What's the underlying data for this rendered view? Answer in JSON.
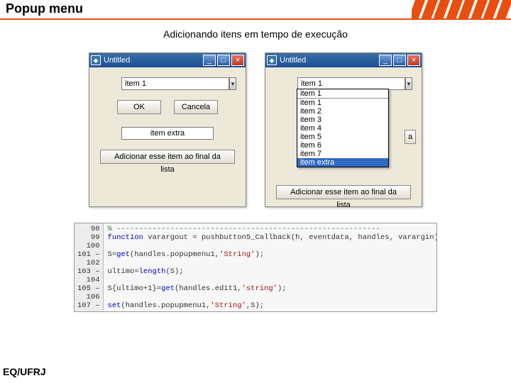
{
  "header": {
    "title": "Popup menu"
  },
  "subtitle": "Adicionando itens em tempo de execução",
  "win_left": {
    "title": "Untitled",
    "min": "_",
    "max": "□",
    "close": "×",
    "combo_value": "item 1",
    "btn_ok": "OK",
    "btn_cancel": "Cancela",
    "edit_value": "item extra",
    "btn_add": "Adicionar esse item ao final da lista"
  },
  "win_right": {
    "title": "Untitled",
    "min": "_",
    "max": "□",
    "close": "×",
    "combo_selected": "item 1",
    "options": [
      "item 1",
      "item 2",
      "item 3",
      "item 4",
      "item 5",
      "item 6",
      "item 7",
      "item extra"
    ],
    "partial_cancel_letter": "a",
    "btn_add": "Adicionar esse item ao final da lista"
  },
  "code": {
    "gutter": [
      "98",
      "99",
      "100",
      "101 –",
      "102",
      "103 –",
      "104",
      "105 –",
      "106",
      "107 –"
    ],
    "lines": [
      {
        "cls": "c-comment",
        "t": "% -----------------------------------------------------------"
      },
      {
        "cls": "",
        "t": "function varargout = pushbutton5_Callback(h, eventdata, handles, varargin)"
      },
      {
        "cls": "",
        "t": ""
      },
      {
        "cls": "",
        "t": "S=get(handles.popupmenu1,'String');"
      },
      {
        "cls": "",
        "t": ""
      },
      {
        "cls": "",
        "t": "ultimo=length(S);"
      },
      {
        "cls": "",
        "t": ""
      },
      {
        "cls": "",
        "t": "S{ultimo+1}=get(handles.edit1,'string');"
      },
      {
        "cls": "",
        "t": ""
      },
      {
        "cls": "",
        "t": "set(handles.popupmenu1,'String',S);"
      }
    ]
  },
  "footer": "EQ/UFRJ"
}
